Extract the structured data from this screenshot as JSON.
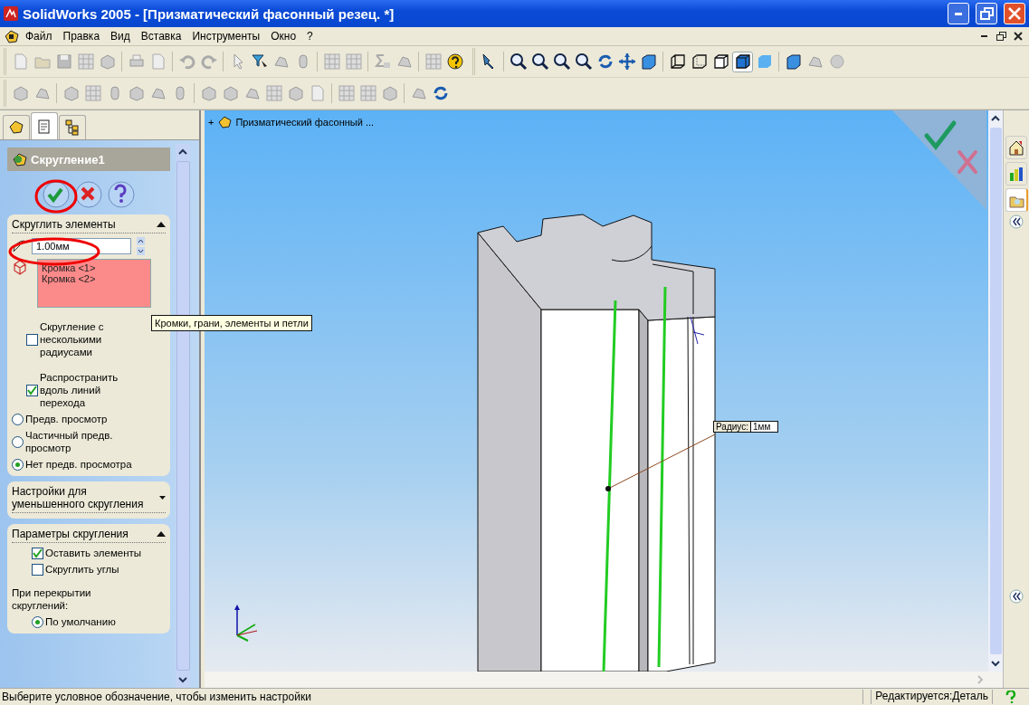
{
  "window": {
    "title": "SolidWorks 2005 - [Призматический фасонный резец. *]"
  },
  "menu": [
    "Файл",
    "Правка",
    "Вид",
    "Вставка",
    "Инструменты",
    "Окно",
    "?"
  ],
  "display_modes": [
    {
      "selected": false
    },
    {
      "selected": false
    },
    {
      "selected": false
    },
    {
      "selected": true
    },
    {
      "selected": false
    }
  ],
  "task_pane_tabs": [
    {
      "selected": false
    },
    {
      "selected": false
    },
    {
      "selected": true
    }
  ],
  "panel_tabs": [
    {
      "selected": false
    },
    {
      "selected": true
    },
    {
      "selected": false
    }
  ],
  "feature": {
    "title": "Скругление1"
  },
  "sections": [
    {
      "title": "Скруглить элементы",
      "expanded": true,
      "radius": "1.00мм",
      "edges": [
        "Кромка <1>",
        "Кромка <2>"
      ],
      "options": [
        {
          "kind": "checkbox",
          "label": "Скругление с несколькими радиусами",
          "checked": false
        },
        {
          "kind": "checkbox",
          "label": "Распространить вдоль линий перехода",
          "checked": true
        },
        {
          "kind": "radio",
          "label": "Предв. просмотр",
          "selected": false
        },
        {
          "kind": "radio",
          "label": "Частичный предв. просмотр",
          "selected": false
        },
        {
          "kind": "radio",
          "label": "Нет предв. просмотра",
          "selected": true
        }
      ]
    },
    {
      "title": "Настройки для уменьшенного скругления",
      "expanded": false
    },
    {
      "title": "Параметры скругления",
      "expanded": true,
      "options": [
        {
          "kind": "checkbox",
          "label": "Оставить элементы",
          "checked": true
        },
        {
          "kind": "checkbox",
          "label": "Скруглить углы",
          "checked": false
        },
        {
          "kind": "text",
          "label": "При перекрытии скруглений:"
        },
        {
          "kind": "radio",
          "label": "По умолчанию",
          "selected": true
        }
      ]
    }
  ],
  "tooltip": "Кромки, грани, элементы и петли",
  "viewport": {
    "expander": "+",
    "tree_label": "Призматический фасонный ...",
    "callout": {
      "label": "Радиус:",
      "value": "1мм"
    }
  },
  "status_bar": {
    "message": "Выберите условное обозначение, чтобы изменить настройки",
    "mode": "Редактируется:Деталь"
  }
}
